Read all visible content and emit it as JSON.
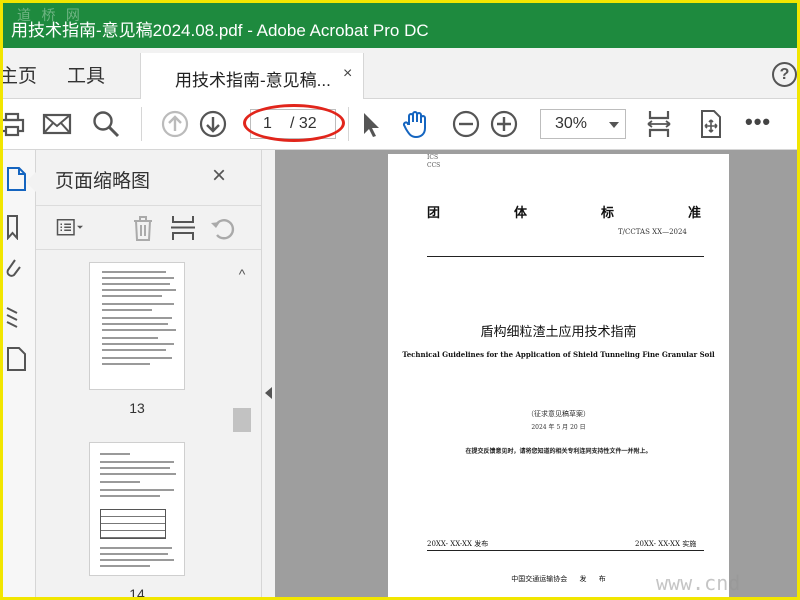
{
  "window": {
    "title": "用技术指南-意见稿2024.08.pdf - Adobe Acrobat Pro DC",
    "watermark_top": "道 桥 网"
  },
  "menu": {
    "home": "主页",
    "tools": "工具"
  },
  "tab": {
    "label": "用技术指南-意见稿...",
    "close": "×"
  },
  "help": "?",
  "toolbar": {
    "page_current": "1",
    "page_total": "/ 32",
    "zoom": "30%",
    "more": "•••"
  },
  "thumbnails_panel": {
    "title": "页面缩略图",
    "close": "×",
    "pages": [
      {
        "label": "13"
      },
      {
        "label": "14"
      }
    ]
  },
  "document": {
    "ics": "ICS",
    "ccs": "CCS",
    "header_chars": [
      "团",
      "体",
      "标",
      "准"
    ],
    "standard_code": "T/CCTAS XX—2024",
    "title_cn": "盾构细粒渣土应用技术指南",
    "title_en": "Technical Guidelines for the Application of Shield Tunneling Fine Granular Soil",
    "draft_label": "（征求意见稿草案）",
    "draft_date": "2024 年 5 月 20 日",
    "note": "在提交反馈意见时，请将您知道的相关专利连同支持性文件一并附上。",
    "issue_date": "20XX- XX-XX 发布",
    "impl_date": "20XX- XX-XX 实施",
    "publisher": "中国交通运输协会 发 布"
  },
  "watermark_bottom": "www.cnd",
  "colors": {
    "titlebar": "#1e8a3e",
    "accent_icon": "#1565c0",
    "highlight_ellipse": "#e1251b",
    "frame": "#f2e600"
  }
}
